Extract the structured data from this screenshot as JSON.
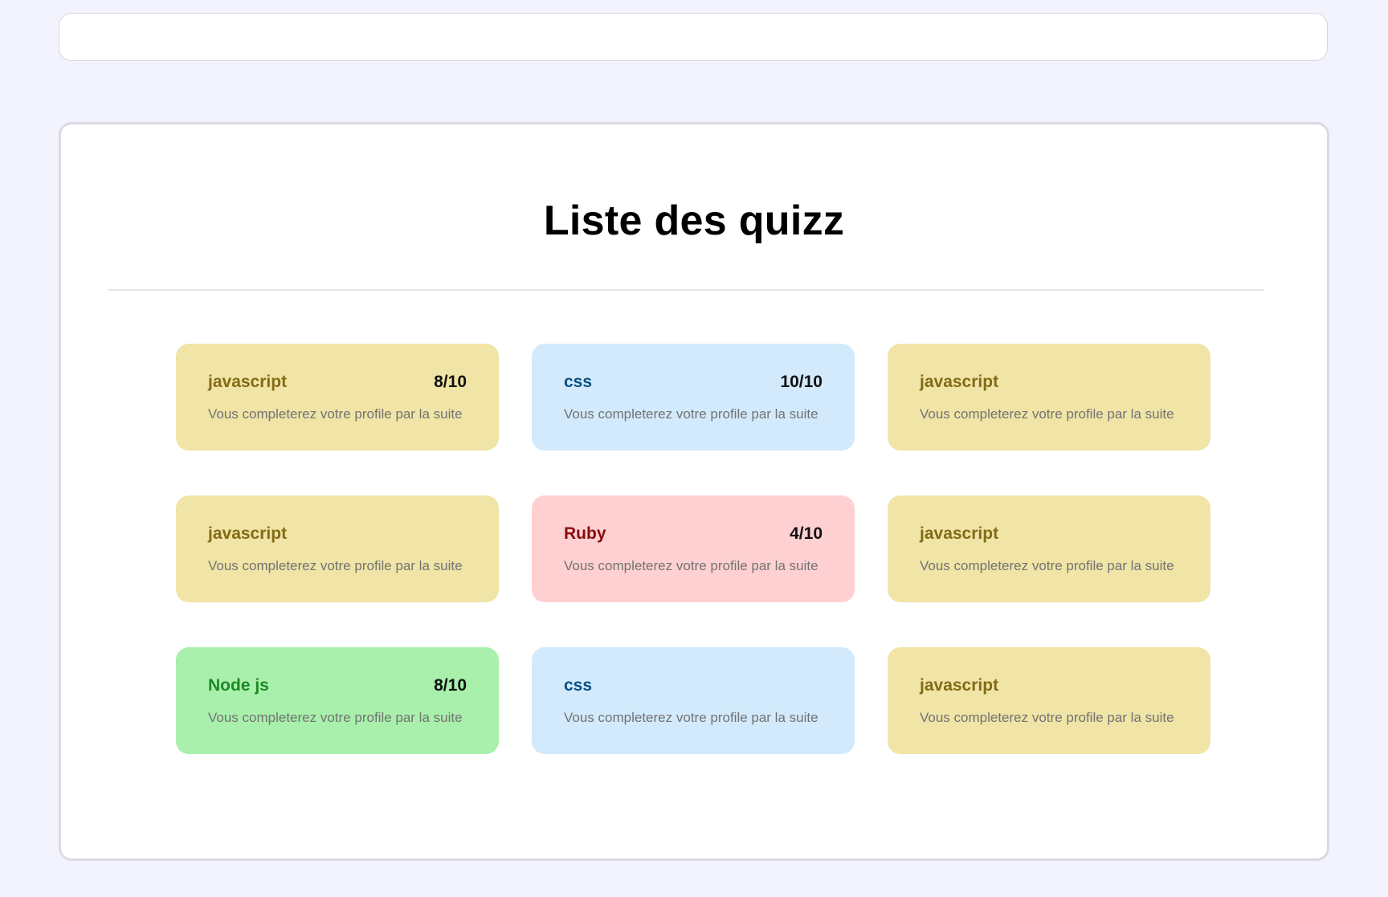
{
  "page": {
    "title": "Liste des quizz"
  },
  "quizzes": [
    {
      "title": "javascript",
      "score": "8/10",
      "description": "Vous completerez votre profile par la suite",
      "theme": "yellow"
    },
    {
      "title": "css",
      "score": "10/10",
      "description": "Vous completerez votre profile par la suite",
      "theme": "blue"
    },
    {
      "title": "javascript",
      "score": "",
      "description": "Vous completerez votre profile par la suite",
      "theme": "yellow"
    },
    {
      "title": "javascript",
      "score": "",
      "description": "Vous completerez votre profile par la suite",
      "theme": "yellow"
    },
    {
      "title": "Ruby",
      "score": "4/10",
      "description": "Vous completerez votre profile par la suite",
      "theme": "red"
    },
    {
      "title": "javascript",
      "score": "",
      "description": "Vous completerez votre profile par la suite",
      "theme": "yellow"
    },
    {
      "title": "Node js",
      "score": "8/10",
      "description": "Vous completerez votre profile par la suite",
      "theme": "green"
    },
    {
      "title": "css",
      "score": "",
      "description": "Vous completerez votre profile par la suite",
      "theme": "blue"
    },
    {
      "title": "javascript",
      "score": "",
      "description": "Vous completerez votre profile par la suite",
      "theme": "yellow"
    }
  ],
  "colors": {
    "background": "#f2f3fd",
    "yellow_card": "#f0e4a6",
    "blue_card": "#d2eafc",
    "red_card": "#ffd0d2",
    "green_card": "#a8f0ab"
  }
}
